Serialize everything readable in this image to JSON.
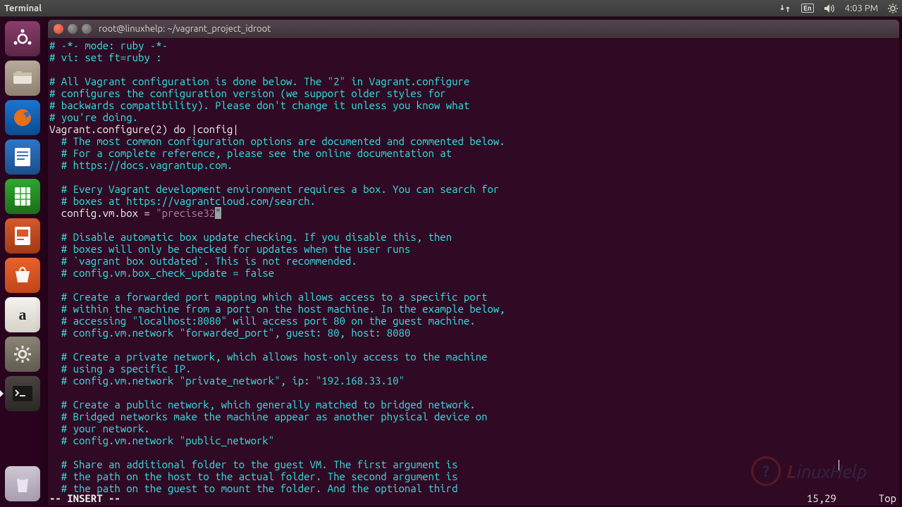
{
  "topbar": {
    "app_title": "Terminal",
    "lang_indicator": "En",
    "clock": "4:03 PM"
  },
  "window": {
    "title": "root@linuxhelp: ~/vagrant_project_idroot"
  },
  "editor": {
    "lines": [
      {
        "indent": 0,
        "kind": "comment",
        "text": "# -*- mode: ruby -*-"
      },
      {
        "indent": 0,
        "kind": "comment",
        "text": "# vi: set ft=ruby :"
      },
      {
        "indent": 0,
        "kind": "blank",
        "text": ""
      },
      {
        "indent": 0,
        "kind": "comment",
        "text": "# All Vagrant configuration is done below. The \"2\" in Vagrant.configure"
      },
      {
        "indent": 0,
        "kind": "comment",
        "text": "# configures the configuration version (we support older styles for"
      },
      {
        "indent": 0,
        "kind": "comment",
        "text": "# backwards compatibility). Please don't change it unless you know what"
      },
      {
        "indent": 0,
        "kind": "comment",
        "text": "# you're doing."
      },
      {
        "indent": 0,
        "kind": "code",
        "text": "Vagrant.configure(2) do |config|"
      },
      {
        "indent": 2,
        "kind": "comment",
        "text": "# The most common configuration options are documented and commented below."
      },
      {
        "indent": 2,
        "kind": "comment",
        "text": "# For a complete reference, please see the online documentation at"
      },
      {
        "indent": 2,
        "kind": "comment",
        "text": "# https://docs.vagrantup.com."
      },
      {
        "indent": 0,
        "kind": "blank",
        "text": ""
      },
      {
        "indent": 2,
        "kind": "comment",
        "text": "# Every Vagrant development environment requires a box. You can search for"
      },
      {
        "indent": 2,
        "kind": "comment",
        "text": "# boxes at https://vagrantcloud.com/search."
      },
      {
        "indent": 2,
        "kind": "box",
        "prefix": "config.vm.box = ",
        "open": "\"",
        "value": "precise32",
        "close": "\""
      },
      {
        "indent": 0,
        "kind": "blank",
        "text": ""
      },
      {
        "indent": 2,
        "kind": "comment",
        "text": "# Disable automatic box update checking. If you disable this, then"
      },
      {
        "indent": 2,
        "kind": "comment",
        "text": "# boxes will only be checked for updates when the user runs"
      },
      {
        "indent": 2,
        "kind": "comment",
        "text": "# `vagrant box outdated`. This is not recommended."
      },
      {
        "indent": 2,
        "kind": "comment",
        "text": "# config.vm.box_check_update = false"
      },
      {
        "indent": 0,
        "kind": "blank",
        "text": ""
      },
      {
        "indent": 2,
        "kind": "comment",
        "text": "# Create a forwarded port mapping which allows access to a specific port"
      },
      {
        "indent": 2,
        "kind": "comment",
        "text": "# within the machine from a port on the host machine. In the example below,"
      },
      {
        "indent": 2,
        "kind": "comment",
        "text": "# accessing \"localhost:8080\" will access port 80 on the guest machine."
      },
      {
        "indent": 2,
        "kind": "comment",
        "text": "# config.vm.network \"forwarded_port\", guest: 80, host: 8080"
      },
      {
        "indent": 0,
        "kind": "blank",
        "text": ""
      },
      {
        "indent": 2,
        "kind": "comment",
        "text": "# Create a private network, which allows host-only access to the machine"
      },
      {
        "indent": 2,
        "kind": "comment",
        "text": "# using a specific IP."
      },
      {
        "indent": 2,
        "kind": "comment",
        "text": "# config.vm.network \"private_network\", ip: \"192.168.33.10\""
      },
      {
        "indent": 0,
        "kind": "blank",
        "text": ""
      },
      {
        "indent": 2,
        "kind": "comment",
        "text": "# Create a public network, which generally matched to bridged network."
      },
      {
        "indent": 2,
        "kind": "comment",
        "text": "# Bridged networks make the machine appear as another physical device on"
      },
      {
        "indent": 2,
        "kind": "comment",
        "text": "# your network."
      },
      {
        "indent": 2,
        "kind": "comment",
        "text": "# config.vm.network \"public_network\""
      },
      {
        "indent": 0,
        "kind": "blank",
        "text": ""
      },
      {
        "indent": 2,
        "kind": "comment",
        "text": "# Share an additional folder to the guest VM. The first argument is"
      },
      {
        "indent": 2,
        "kind": "comment",
        "text": "# the path on the host to the actual folder. The second argument is"
      },
      {
        "indent": 2,
        "kind": "comment",
        "text": "# the path on the guest to mount the folder. And the optional third"
      }
    ],
    "mode": "-- INSERT --",
    "rowcol": "15,29",
    "scrollpos": "Top"
  },
  "watermark": {
    "first": "L",
    "rest": "inuxHelp"
  }
}
